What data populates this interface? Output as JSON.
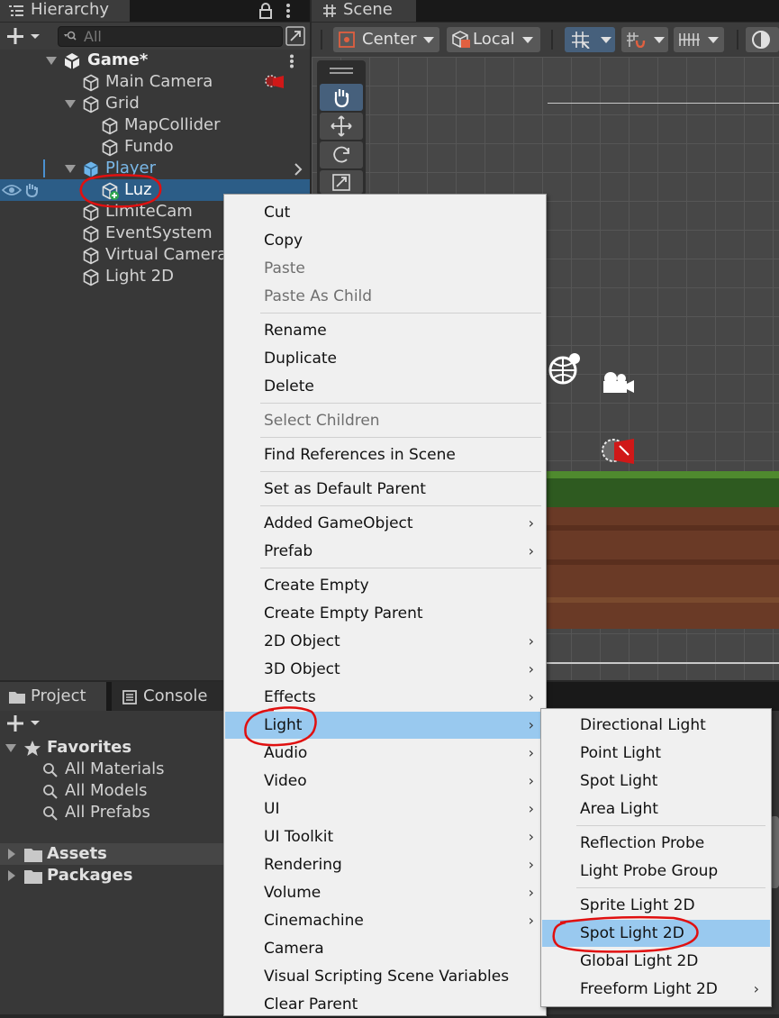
{
  "hierarchy": {
    "tab_label": "Hierarchy",
    "search_placeholder": "All",
    "scene_name": "Game*",
    "items": [
      {
        "label": "Main Camera"
      },
      {
        "label": "Grid"
      },
      {
        "label": "MapCollider"
      },
      {
        "label": "Fundo"
      },
      {
        "label": "Player"
      },
      {
        "label": "Luz"
      },
      {
        "label": "LimiteCam"
      },
      {
        "label": "EventSystem"
      },
      {
        "label": "Virtual Camera"
      },
      {
        "label": "Light 2D"
      }
    ]
  },
  "scene": {
    "tab_label": "Scene",
    "pivot_label": "Center",
    "space_label": "Local"
  },
  "project": {
    "tabs": [
      {
        "label": "Project"
      },
      {
        "label": "Console"
      }
    ],
    "favorites_label": "Favorites",
    "favorites": [
      {
        "label": "All Materials"
      },
      {
        "label": "All Models"
      },
      {
        "label": "All Prefabs"
      }
    ],
    "assets_label": "Assets",
    "packages_label": "Packages"
  },
  "context_menu": {
    "items": [
      {
        "label": "Cut"
      },
      {
        "label": "Copy"
      },
      {
        "label": "Paste"
      },
      {
        "label": "Paste As Child"
      },
      {
        "label": "Rename"
      },
      {
        "label": "Duplicate"
      },
      {
        "label": "Delete"
      },
      {
        "label": "Select Children"
      },
      {
        "label": "Find References in Scene"
      },
      {
        "label": "Set as Default Parent"
      },
      {
        "label": "Added GameObject"
      },
      {
        "label": "Prefab"
      },
      {
        "label": "Create Empty"
      },
      {
        "label": "Create Empty Parent"
      },
      {
        "label": "2D Object"
      },
      {
        "label": "3D Object"
      },
      {
        "label": "Effects"
      },
      {
        "label": "Light"
      },
      {
        "label": "Audio"
      },
      {
        "label": "Video"
      },
      {
        "label": "UI"
      },
      {
        "label": "UI Toolkit"
      },
      {
        "label": "Rendering"
      },
      {
        "label": "Volume"
      },
      {
        "label": "Cinemachine"
      },
      {
        "label": "Camera"
      },
      {
        "label": "Visual Scripting Scene Variables"
      },
      {
        "label": "Clear Parent"
      }
    ]
  },
  "light_submenu": {
    "items": [
      {
        "label": "Directional Light"
      },
      {
        "label": "Point Light"
      },
      {
        "label": "Spot Light"
      },
      {
        "label": "Area Light"
      },
      {
        "label": "Reflection Probe"
      },
      {
        "label": "Light Probe Group"
      },
      {
        "label": "Sprite Light 2D"
      },
      {
        "label": "Spot Light 2D"
      },
      {
        "label": "Global Light 2D"
      },
      {
        "label": "Freeform Light 2D"
      }
    ]
  },
  "colors": {
    "menu_highlight": "#99c9ef",
    "selection": "#2c5d87",
    "prefab_blue": "#7ab8e8",
    "annotation_red": "#e01010"
  }
}
